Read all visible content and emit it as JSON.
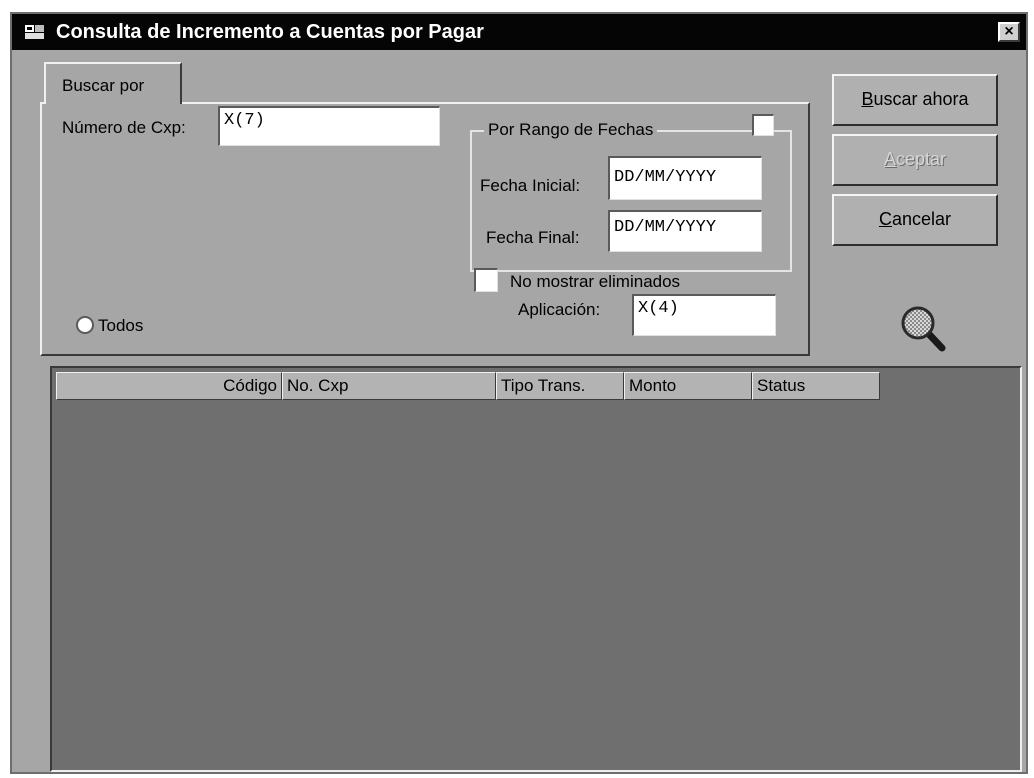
{
  "window": {
    "title": "Consulta de Incremento a Cuentas por Pagar",
    "close_label": "×"
  },
  "tab": {
    "label": "Buscar por"
  },
  "form": {
    "numero_label": "Número de Cxp:",
    "numero_value": "X(7)",
    "rango_label": "Por Rango de Fechas",
    "rango_checked": false,
    "fecha_inicial_label": "Fecha Inicial:",
    "fecha_inicial_value": "DD/MM/YYYY",
    "fecha_final_label": "Fecha Final:",
    "fecha_final_value": "DD/MM/YYYY",
    "no_mostrar_label": "No mostrar eliminados",
    "no_mostrar_checked": false,
    "aplicacion_label": "Aplicación:",
    "aplicacion_value": "X(4)",
    "todos_label": "Todos"
  },
  "buttons": {
    "buscar": {
      "hotkey": "B",
      "rest": "uscar ahora",
      "enabled": true
    },
    "aceptar": {
      "hotkey": "A",
      "rest": "ceptar",
      "enabled": false
    },
    "cancelar": {
      "hotkey": "C",
      "rest": "ancelar",
      "enabled": true
    }
  },
  "grid": {
    "columns": [
      "Código",
      "No. Cxp",
      "Tipo Trans.",
      "Monto",
      "Status"
    ],
    "rows": []
  },
  "icons": {
    "app": "app-window-icon",
    "search": "magnifier-search-icon"
  }
}
